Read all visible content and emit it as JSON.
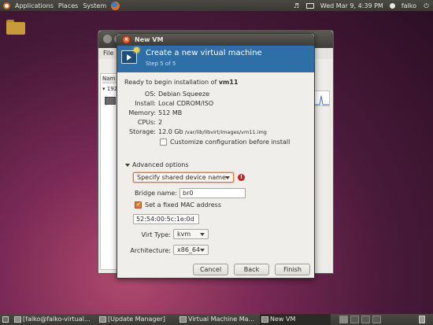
{
  "top_panel": {
    "menus": [
      "Applications",
      "Places",
      "System"
    ],
    "clock": "Wed Mar 9,  4:39 PM",
    "user": "falko"
  },
  "vmm_window": {
    "menu_file": "File",
    "name_column": "Nam",
    "host_row": "192."
  },
  "dialog": {
    "window_title": "New VM",
    "header_title": "Create a new virtual machine",
    "header_step": "Step 5 of 5",
    "ready_prefix": "Ready to begin installation of ",
    "vm_name": "vm11",
    "summary": [
      {
        "label": "OS:",
        "value": "Debian Squeeze"
      },
      {
        "label": "Install:",
        "value": "Local CDROM/ISO"
      },
      {
        "label": "Memory:",
        "value": "512 MB"
      },
      {
        "label": "CPUs:",
        "value": "2"
      },
      {
        "label": "Storage:",
        "value_main": "12.0 Gb",
        "value_path": " /var/lib/libvirt/images/vm11.img"
      }
    ],
    "customize_label": "Customize configuration before install",
    "customize_checked": false,
    "advanced_label": "Advanced options",
    "network_combo": "Specify shared device name",
    "bridge_label": "Bridge name:",
    "bridge_value": "br0",
    "fixed_mac_label": "Set a fixed MAC address",
    "fixed_mac_checked": true,
    "mac_value": "52:54:00:5c:1e:0d",
    "virt_type_label": "Virt Type:",
    "virt_type_value": "kvm",
    "arch_label": "Architecture:",
    "arch_value": "x86_64",
    "buttons": {
      "cancel": "Cancel",
      "back": "Back",
      "finish": "Finish"
    }
  },
  "taskbar": {
    "tasks": [
      "[falko@falko-virtual...",
      "[Update Manager]",
      "Virtual Machine Ma...",
      "New VM"
    ]
  },
  "colors": {
    "header_blue": "#2e6fa8",
    "accent_orange": "#e2773a",
    "warning_red": "#c42020"
  }
}
